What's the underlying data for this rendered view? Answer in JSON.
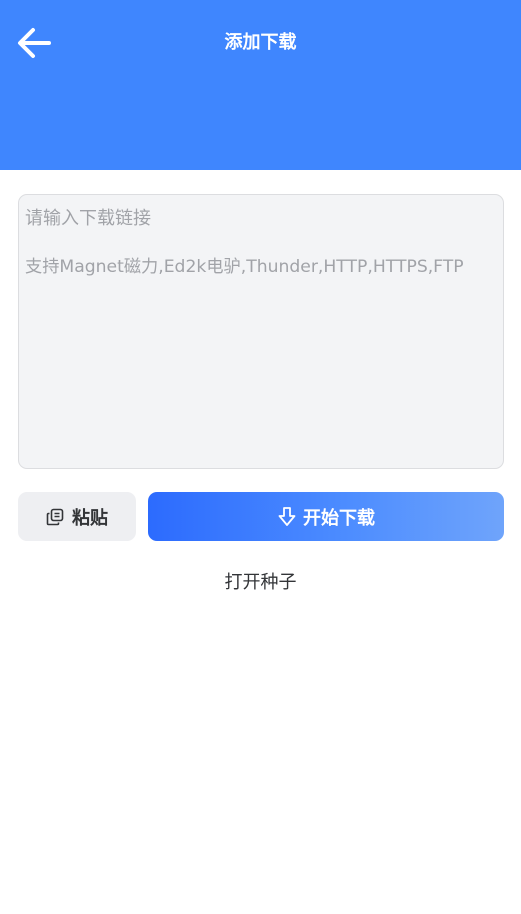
{
  "header": {
    "title": "添加下载",
    "back_icon": "arrow-left-icon",
    "background": "#3f86fe"
  },
  "link_input": {
    "value": "",
    "placeholder_line1": "请输入下载链接",
    "placeholder_line2": "支持Magnet磁力,Ed2k电驴,Thunder,HTTP,HTTPS,FTP"
  },
  "actions": {
    "paste_label": "粘贴",
    "paste_icon": "copy-icon",
    "start_label": "开始下载",
    "start_icon": "download-arrow-icon",
    "accent_color": "#2c6bfe"
  },
  "open_torrent_label": "打开种子"
}
